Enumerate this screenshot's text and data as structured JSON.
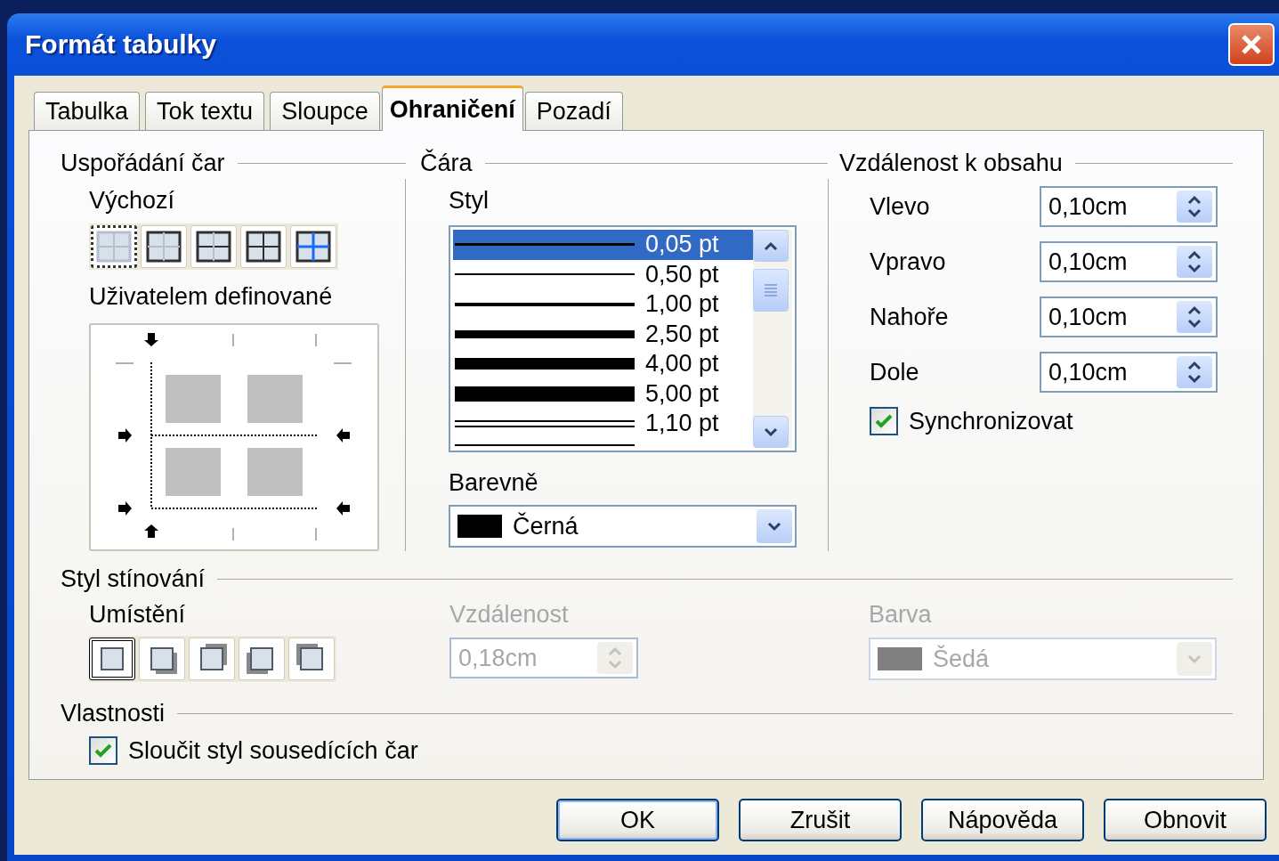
{
  "window": {
    "title": "Formát tabulky"
  },
  "tabs": [
    {
      "label": "Tabulka",
      "selected": false
    },
    {
      "label": "Tok textu",
      "selected": false
    },
    {
      "label": "Sloupce",
      "selected": false
    },
    {
      "label": "Ohraničení",
      "selected": true
    },
    {
      "label": "Pozadí",
      "selected": false
    }
  ],
  "line_arrangement": {
    "title": "Uspořádání čar",
    "default_label": "Výchozí",
    "presets": [
      {
        "kind": "none",
        "selected": true
      },
      {
        "kind": "outer",
        "selected": false
      },
      {
        "kind": "outer-horizontal",
        "selected": false
      },
      {
        "kind": "all",
        "selected": false
      },
      {
        "kind": "outer-inner",
        "selected": false
      }
    ],
    "user_defined_label": "Uživatelem definované"
  },
  "line": {
    "title": "Čára",
    "style_label": "Styl",
    "styles": [
      {
        "label": "0,05 pt",
        "kind": "hairline",
        "selected": true
      },
      {
        "label": "0,50 pt",
        "kind": "thin",
        "selected": false
      },
      {
        "label": "1,00 pt",
        "kind": "medium",
        "selected": false
      },
      {
        "label": "2,50 pt",
        "kind": "thick",
        "selected": false
      },
      {
        "label": "4,00 pt",
        "kind": "heavy",
        "selected": false
      },
      {
        "label": "5,00 pt",
        "kind": "extra",
        "selected": false
      },
      {
        "label": "1,10 pt",
        "kind": "double",
        "selected": false
      }
    ],
    "color_label": "Barevně",
    "color_value": "Černá",
    "color": "#000000"
  },
  "spacing": {
    "title": "Vzdálenost k obsahu",
    "fields": [
      {
        "label": "Vlevo",
        "value": "0,10cm"
      },
      {
        "label": "Vpravo",
        "value": "0,10cm"
      },
      {
        "label": "Nahoře",
        "value": "0,10cm"
      },
      {
        "label": "Dole",
        "value": "0,10cm"
      }
    ],
    "sync": {
      "label": "Synchronizovat",
      "checked": true
    }
  },
  "shadow": {
    "title": "Styl stínování",
    "position_label": "Umístění",
    "positions": [
      {
        "kind": "none",
        "selected": true
      },
      {
        "kind": "bottom-right",
        "selected": false
      },
      {
        "kind": "top-right",
        "selected": false
      },
      {
        "kind": "bottom-left",
        "selected": false
      },
      {
        "kind": "top-left",
        "selected": false
      }
    ],
    "distance_label": "Vzdálenost",
    "distance": "0,18cm",
    "color_label": "Barva",
    "color_value": "Šedá",
    "color": "#808080",
    "disabled": true
  },
  "properties": {
    "title": "Vlastnosti",
    "merge": {
      "label": "Sloučit styl sousedících čar",
      "checked": true
    }
  },
  "buttons": [
    {
      "label": "OK",
      "default": true
    },
    {
      "label": "Zrušit",
      "default": false
    },
    {
      "label": "Nápověda",
      "default": false
    },
    {
      "label": "Obnovit",
      "default": false
    }
  ]
}
